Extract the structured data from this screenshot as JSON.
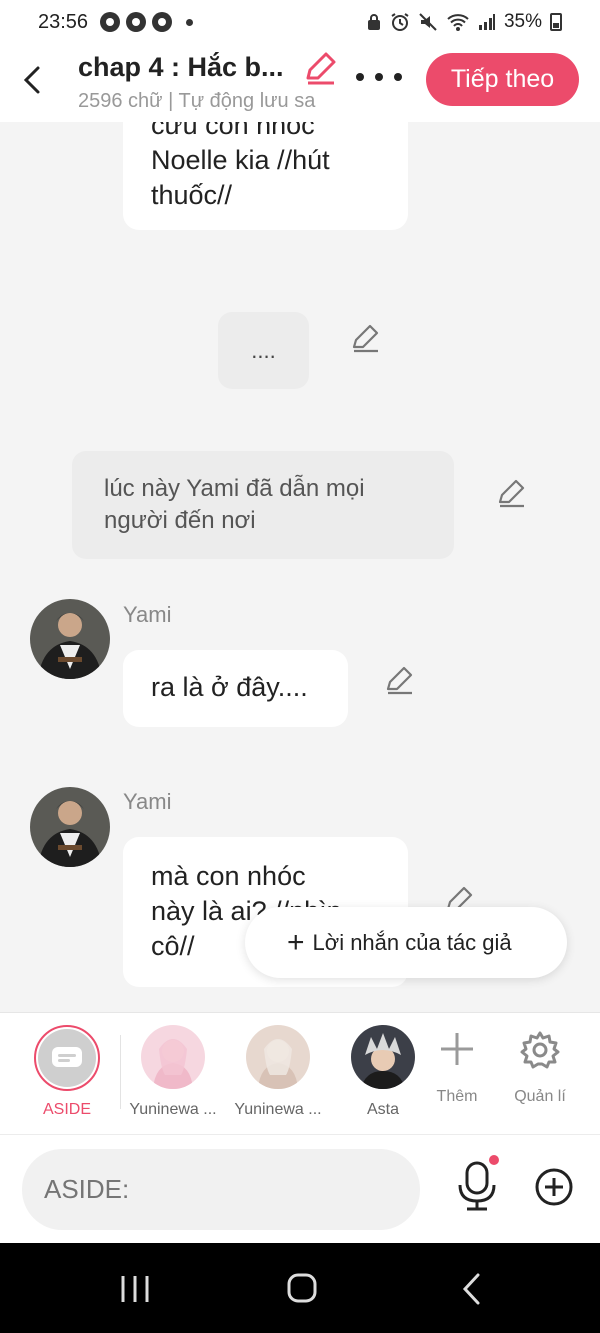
{
  "status_bar": {
    "time": "23:56",
    "battery": "35%"
  },
  "header": {
    "title": "chap 4 : Hắc b...",
    "subtitle": "2596 chữ | Tự động lưu sa",
    "next_label": "Tiếp theo"
  },
  "messages": {
    "top_bubble": [
      "cứu con nhóc",
      "Noelle kia //hút",
      "thuốc//"
    ],
    "ellipsis": "....",
    "narration": [
      "lúc này Yami đã dẫn mọi",
      "người đến nơi"
    ],
    "msg2": {
      "speaker": "Yami",
      "text": "ra là ở đây...."
    },
    "msg3": {
      "speaker": "Yami",
      "lines": [
        "mà con nhóc",
        "này là ai? //nhìn",
        "cô//"
      ]
    }
  },
  "author_note": {
    "label": "Lời nhắn của tác giả"
  },
  "characters": [
    {
      "name": "ASIDE"
    },
    {
      "name": "Yuninewa ..."
    },
    {
      "name": "Yuninewa ..."
    },
    {
      "name": "Asta"
    }
  ],
  "tools": {
    "add_label": "Thêm",
    "manage_label": "Quản lí"
  },
  "input": {
    "placeholder": "ASIDE:"
  },
  "colors": {
    "accent": "#ec4b6b"
  }
}
